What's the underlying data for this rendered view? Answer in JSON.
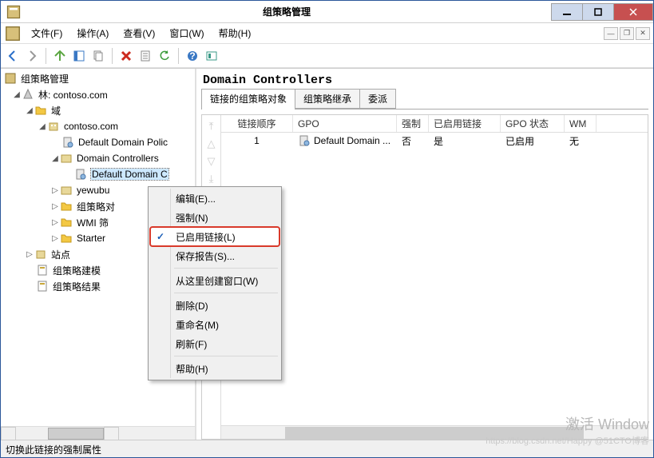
{
  "window": {
    "title": "组策略管理"
  },
  "menubar": {
    "file": "文件(F)",
    "action": "操作(A)",
    "view": "查看(V)",
    "window": "窗口(W)",
    "help": "帮助(H)"
  },
  "tree": {
    "root": "组策略管理",
    "forest": "林: contoso.com",
    "domains": "域",
    "domain": "contoso.com",
    "ddp": "Default Domain Polic",
    "dc": "Domain Controllers",
    "dcgpo": "Default Domain C",
    "yewubu": "yewubu",
    "gpoobj": "组策略对",
    "wmi": "WMI 筛",
    "starter": "Starter",
    "sites": "站点",
    "modeling": "组策略建模",
    "results": "组策略结果"
  },
  "right": {
    "heading": "Domain Controllers",
    "tabs": {
      "linked": "链接的组策略对象",
      "inherit": "组策略继承",
      "delegate": "委派"
    },
    "columns": {
      "order": "链接顺序",
      "gpo": "GPO",
      "enforced": "强制",
      "enabled": "已启用链接",
      "status": "GPO 状态",
      "wmi": "WM"
    },
    "rows": [
      {
        "order": "1",
        "gpo": "Default Domain ...",
        "enforced": "否",
        "enabled": "是",
        "status": "已启用",
        "wmi": "无"
      }
    ]
  },
  "context": {
    "edit": "编辑(E)...",
    "enforce": "强制(N)",
    "link_enabled": "已启用链接(L)",
    "save_report": "保存报告(S)...",
    "new_window": "从这里创建窗口(W)",
    "delete": "删除(D)",
    "rename": "重命名(M)",
    "refresh": "刷新(F)",
    "help": "帮助(H)"
  },
  "status": "切换此链接的强制属性",
  "watermark": {
    "line1": "激活 Window",
    "line2": "https://blog.csdn.net/Happy  @51CTO博客"
  }
}
